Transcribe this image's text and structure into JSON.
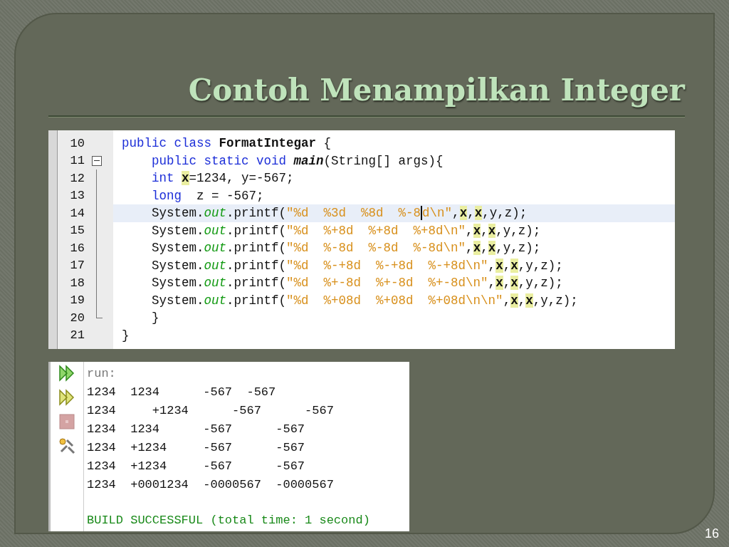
{
  "slide": {
    "title": "Contoh Menampilkan Integer",
    "page_number": "16"
  },
  "editor": {
    "lines": [
      {
        "number": "10",
        "current": false,
        "kind": "none",
        "tokens": [
          {
            "t": "public class ",
            "kind": "kw"
          },
          {
            "t": "FormatIntegar",
            "kind": "cls"
          },
          {
            "t": " {",
            "kind": "plain"
          }
        ]
      },
      {
        "number": "11",
        "current": false,
        "kind": "start",
        "tokens": [
          {
            "t": "    public static void ",
            "kind": "kw"
          },
          {
            "t": "main",
            "kind": "method"
          },
          {
            "t": "(String[] args){",
            "kind": "plain"
          }
        ]
      },
      {
        "number": "12",
        "current": false,
        "kind": "inner",
        "tokens": [
          {
            "t": "    int ",
            "kind": "kw"
          },
          {
            "t": "x",
            "kind": "var"
          },
          {
            "t": "=1234, y=-567;",
            "kind": "plain"
          }
        ]
      },
      {
        "number": "13",
        "current": false,
        "kind": "inner",
        "tokens": [
          {
            "t": "    long ",
            "kind": "kw"
          },
          {
            "t": " z = -567;",
            "kind": "plain"
          }
        ]
      },
      {
        "number": "14",
        "current": true,
        "kind": "inner",
        "tokens": [
          {
            "t": "    System.",
            "kind": "plain"
          },
          {
            "t": "out",
            "kind": "field"
          },
          {
            "t": ".printf(",
            "kind": "plain"
          },
          {
            "t": "\"%d  %3d  %8d  %-8",
            "kind": "str"
          },
          {
            "t": "d\\n\"",
            "kind": "str",
            "caret": true
          },
          {
            "t": ",",
            "kind": "plain"
          },
          {
            "t": "x",
            "kind": "var"
          },
          {
            "t": ",",
            "kind": "plain"
          },
          {
            "t": "x",
            "kind": "var"
          },
          {
            "t": ",y,z);",
            "kind": "plain"
          }
        ]
      },
      {
        "number": "15",
        "current": false,
        "kind": "inner",
        "tokens": [
          {
            "t": "    System.",
            "kind": "plain"
          },
          {
            "t": "out",
            "kind": "field"
          },
          {
            "t": ".printf(",
            "kind": "plain"
          },
          {
            "t": "\"%d  %+8d  %+8d  %+8d\\n\"",
            "kind": "str"
          },
          {
            "t": ",",
            "kind": "plain"
          },
          {
            "t": "x",
            "kind": "var"
          },
          {
            "t": ",",
            "kind": "plain"
          },
          {
            "t": "x",
            "kind": "var"
          },
          {
            "t": ",y,z);",
            "kind": "plain"
          }
        ]
      },
      {
        "number": "16",
        "current": false,
        "kind": "inner",
        "tokens": [
          {
            "t": "    System.",
            "kind": "plain"
          },
          {
            "t": "out",
            "kind": "field"
          },
          {
            "t": ".printf(",
            "kind": "plain"
          },
          {
            "t": "\"%d  %-8d  %-8d  %-8d\\n\"",
            "kind": "str"
          },
          {
            "t": ",",
            "kind": "plain"
          },
          {
            "t": "x",
            "kind": "var"
          },
          {
            "t": ",",
            "kind": "plain"
          },
          {
            "t": "x",
            "kind": "var"
          },
          {
            "t": ",y,z);",
            "kind": "plain"
          }
        ]
      },
      {
        "number": "17",
        "current": false,
        "kind": "inner",
        "tokens": [
          {
            "t": "    System.",
            "kind": "plain"
          },
          {
            "t": "out",
            "kind": "field"
          },
          {
            "t": ".printf(",
            "kind": "plain"
          },
          {
            "t": "\"%d  %-+8d  %-+8d  %-+8d\\n\"",
            "kind": "str"
          },
          {
            "t": ",",
            "kind": "plain"
          },
          {
            "t": "x",
            "kind": "var"
          },
          {
            "t": ",",
            "kind": "plain"
          },
          {
            "t": "x",
            "kind": "var"
          },
          {
            "t": ",y,z);",
            "kind": "plain"
          }
        ]
      },
      {
        "number": "18",
        "current": false,
        "kind": "inner",
        "tokens": [
          {
            "t": "    System.",
            "kind": "plain"
          },
          {
            "t": "out",
            "kind": "field"
          },
          {
            "t": ".printf(",
            "kind": "plain"
          },
          {
            "t": "\"%d  %+-8d  %+-8d  %+-8d\\n\"",
            "kind": "str"
          },
          {
            "t": ",",
            "kind": "plain"
          },
          {
            "t": "x",
            "kind": "var"
          },
          {
            "t": ",",
            "kind": "plain"
          },
          {
            "t": "x",
            "kind": "var"
          },
          {
            "t": ",y,z);",
            "kind": "plain"
          }
        ]
      },
      {
        "number": "19",
        "current": false,
        "kind": "inner",
        "tokens": [
          {
            "t": "    System.",
            "kind": "plain"
          },
          {
            "t": "out",
            "kind": "field"
          },
          {
            "t": ".printf(",
            "kind": "plain"
          },
          {
            "t": "\"%d  %+08d  %+08d  %+08d\\n\\n\"",
            "kind": "str"
          },
          {
            "t": ",",
            "kind": "plain"
          },
          {
            "t": "x",
            "kind": "var"
          },
          {
            "t": ",",
            "kind": "plain"
          },
          {
            "t": "x",
            "kind": "var"
          },
          {
            "t": ",y,z);",
            "kind": "plain"
          }
        ]
      },
      {
        "number": "20",
        "current": false,
        "kind": "end",
        "tokens": [
          {
            "t": "    }",
            "kind": "plain"
          }
        ]
      },
      {
        "number": "21",
        "current": false,
        "kind": "none",
        "tokens": [
          {
            "t": "}",
            "kind": "plain"
          }
        ]
      }
    ]
  },
  "output": {
    "tools": [
      {
        "kind": "run"
      },
      {
        "kind": "rerun"
      },
      {
        "kind": "stop"
      },
      {
        "kind": "settings"
      }
    ],
    "lines": [
      {
        "text": "run:",
        "kind": "info"
      },
      {
        "text": "1234  1234      -567  -567",
        "kind": "out"
      },
      {
        "text": "1234     +1234      -567      -567",
        "kind": "out"
      },
      {
        "text": "1234  1234      -567      -567",
        "kind": "out"
      },
      {
        "text": "1234  +1234     -567      -567",
        "kind": "out"
      },
      {
        "text": "1234  +1234     -567      -567",
        "kind": "out"
      },
      {
        "text": "1234  +0001234  -0000567  -0000567",
        "kind": "out"
      },
      {
        "text": "BUILD SUCCESSFUL (total time: 1 second)",
        "kind": "success"
      }
    ]
  }
}
